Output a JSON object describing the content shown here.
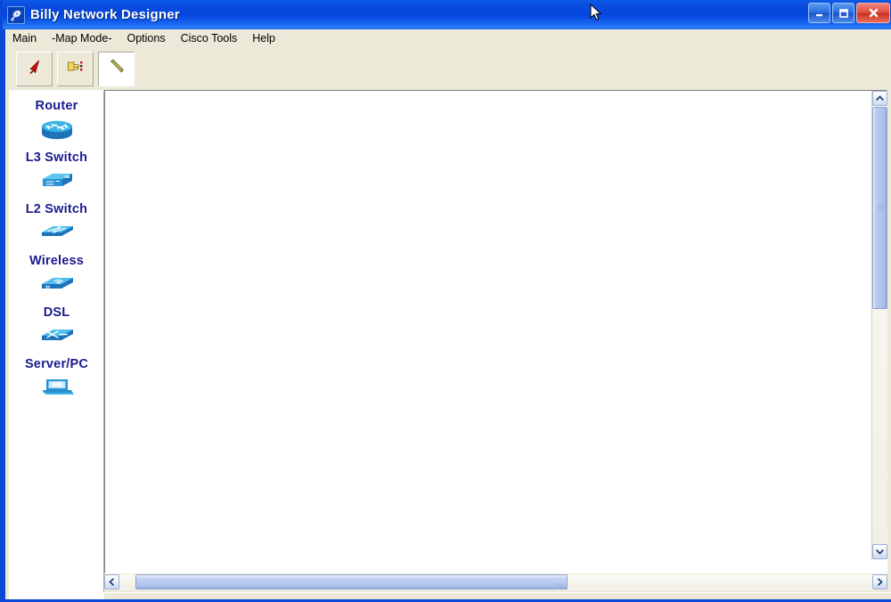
{
  "window": {
    "title": "Billy Network Designer",
    "app_icon": "satellite-dish-icon",
    "controls": {
      "minimize": "minimize-button",
      "maximize": "maximize-button",
      "close": "close-button"
    }
  },
  "menubar": {
    "items": [
      {
        "label": "Main"
      },
      {
        "label": "-Map Mode-"
      },
      {
        "label": "Options"
      },
      {
        "label": "Cisco Tools"
      },
      {
        "label": "Help"
      }
    ]
  },
  "toolbar": {
    "buttons": [
      {
        "name": "select-tool",
        "icon": "red-arrow-cursor-icon",
        "active": false
      },
      {
        "name": "move-tool",
        "icon": "hand-pointer-icon",
        "active": false
      },
      {
        "name": "draw-link-tool",
        "icon": "pencil-icon",
        "active": true
      }
    ]
  },
  "sidebar": {
    "items": [
      {
        "label": "Router",
        "icon": "cisco-router-icon"
      },
      {
        "label": "L3 Switch",
        "icon": "cisco-l3-switch-icon"
      },
      {
        "label": "L2 Switch",
        "icon": "cisco-l2-switch-icon"
      },
      {
        "label": "Wireless",
        "icon": "cisco-wireless-ap-icon"
      },
      {
        "label": "DSL",
        "icon": "cisco-dsl-modem-icon"
      },
      {
        "label": "Server/PC",
        "icon": "cisco-server-pc-icon"
      }
    ]
  },
  "canvas": {
    "background": "#ffffff",
    "content": "",
    "scroll": {
      "vertical": {
        "thumb_top_pct": 4,
        "thumb_height_pct": 43
      },
      "horizontal": {
        "thumb_left_pct": 4,
        "thumb_width_pct": 56
      }
    }
  },
  "statusbar": {
    "text": ""
  },
  "colors": {
    "titlebar_blue": "#0446dd",
    "window_frame": "#0a49d8",
    "chrome": "#ece9d8",
    "label_navy": "#1b1b8f",
    "icon_cyan": "#29a8e0",
    "icon_blue": "#1b66c9"
  }
}
